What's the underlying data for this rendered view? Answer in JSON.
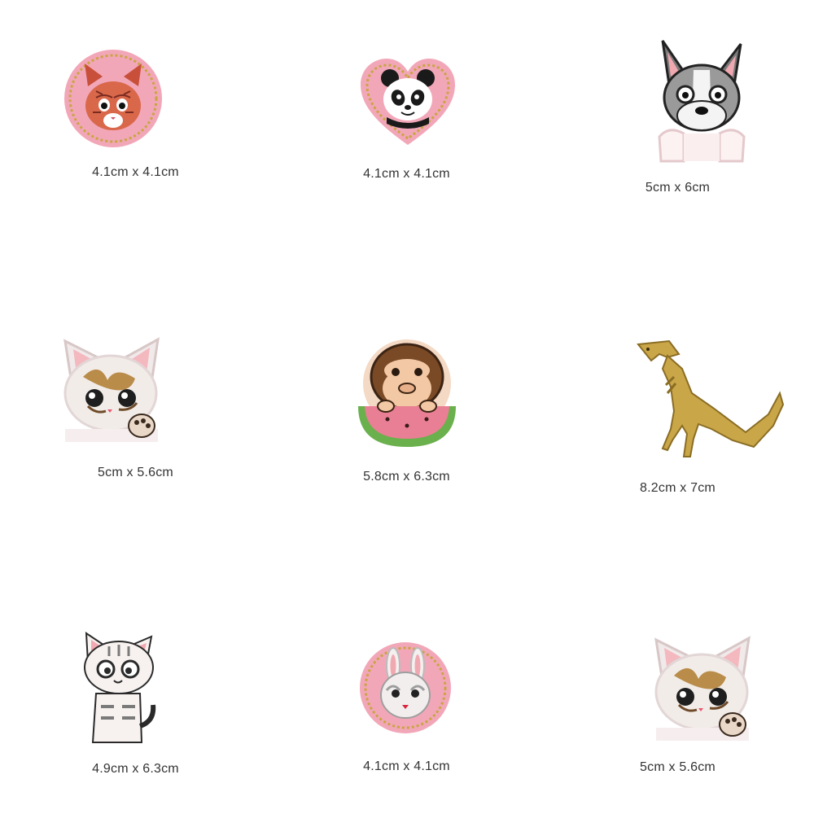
{
  "patches": [
    {
      "name": "Red tabby cat round patch",
      "size": "4.1cm x 4.1cm",
      "icon": "cat-round-icon"
    },
    {
      "name": "Panda heart patch",
      "size": "4.1cm x 4.1cm",
      "icon": "panda-heart-icon"
    },
    {
      "name": "Boston terrier dog patch",
      "size": "5cm x 6cm",
      "icon": "dog-icon"
    },
    {
      "name": "Calico kitten patch",
      "size": "5cm x 5.6cm",
      "icon": "kitten-icon"
    },
    {
      "name": "Monkey with watermelon patch",
      "size": "5.8cm x 6.3cm",
      "icon": "monkey-watermelon-icon"
    },
    {
      "name": "Dinosaur patch",
      "size": "8.2cm x 7cm",
      "icon": "dinosaur-icon"
    },
    {
      "name": "Grey tabby kitten patch",
      "size": "4.9cm x 6.3cm",
      "icon": "grey-kitten-icon"
    },
    {
      "name": "Bunny round patch",
      "size": "4.1cm x 4.1cm",
      "icon": "bunny-round-icon"
    },
    {
      "name": "Calico kitten patch",
      "size": "5cm x 5.6cm",
      "icon": "kitten-icon"
    }
  ]
}
